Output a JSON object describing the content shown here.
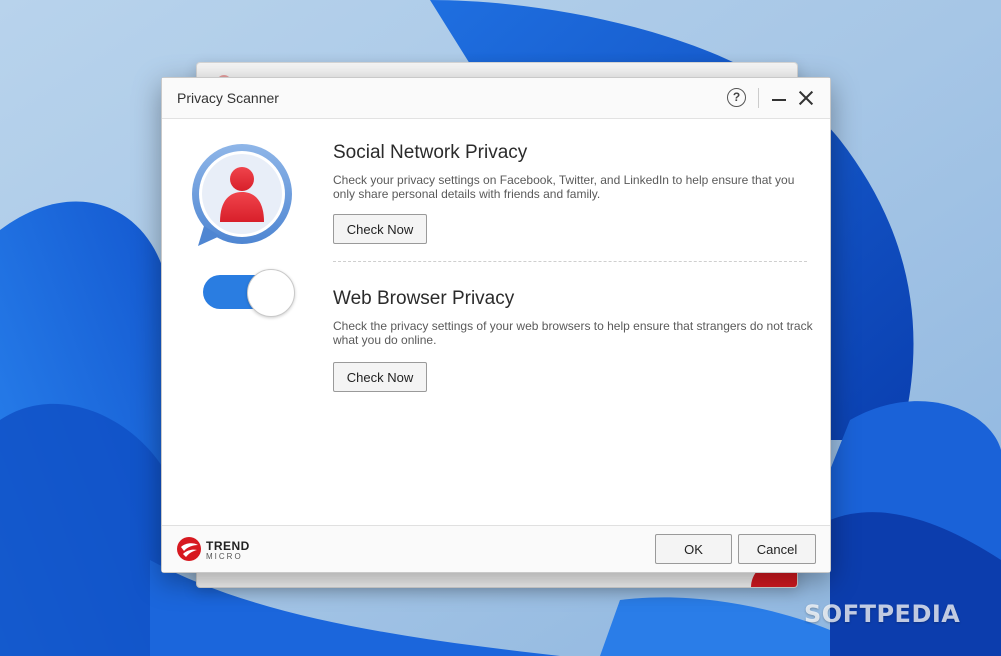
{
  "dialog": {
    "title": "Privacy Scanner",
    "help_icon": "help-icon",
    "minimize_icon": "minimize-icon",
    "close_icon": "close-icon"
  },
  "social": {
    "heading": "Social Network Privacy",
    "description": "Check your privacy settings on Facebook, Twitter, and LinkedIn to help ensure that you only share personal details with friends and family.",
    "button_label": "Check Now",
    "icon": "user-profile-icon"
  },
  "browser": {
    "heading": "Web Browser Privacy",
    "description": "Check the privacy settings of your web browsers to help ensure that strangers do not track what you do online.",
    "button_label": "Check Now",
    "icon": "toggle-switch-icon"
  },
  "footer": {
    "brand_line1": "TREND",
    "brand_line2": "MICRO",
    "ok_label": "OK",
    "cancel_label": "Cancel"
  },
  "watermark": "SOFTPEDIA",
  "colors": {
    "accent_blue": "#2a7de1",
    "brand_red": "#d71920",
    "avatar_red": "#e8323c"
  }
}
